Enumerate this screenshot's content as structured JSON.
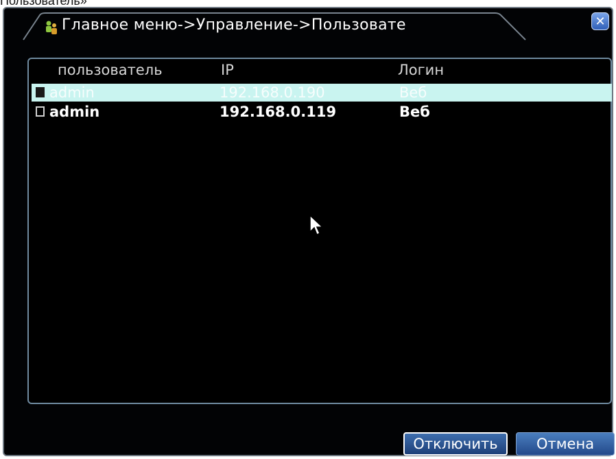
{
  "caption": "Пользователь»",
  "dialog": {
    "title": "Главное меню->Управление->Пользовате",
    "title_icon": "users-icon",
    "close_icon": "close-icon"
  },
  "table": {
    "headers": [
      "пользователь",
      "IP",
      "Логин"
    ],
    "rows": [
      {
        "user": "admin",
        "ip": "192.168.0.190",
        "login": "Веб",
        "selected": true
      },
      {
        "user": "admin",
        "ip": "192.168.0.119",
        "login": "Веб",
        "selected": false
      }
    ]
  },
  "buttons": {
    "disconnect": "Отключить",
    "cancel": "Отмена"
  },
  "colors": {
    "background": "#020305",
    "selection": "#c9f4f0",
    "button": "#2f5fa0"
  }
}
